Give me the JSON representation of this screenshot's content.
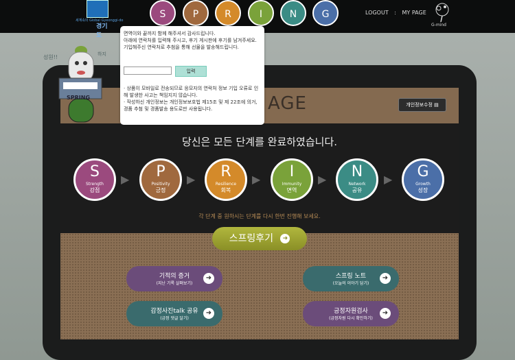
{
  "header": {
    "logo": {
      "text": "경기도",
      "sub": "세계속의 Global Gyeonggi-do"
    },
    "nav": [
      "S",
      "P",
      "R",
      "I",
      "N",
      "G"
    ],
    "logout": "LOGOUT",
    "separator": ":",
    "mypage": "MY PAGE",
    "gmind": "G-mind"
  },
  "mascot": {
    "label": "SPRING",
    "note1": "성원!!",
    "note2": "하지"
  },
  "popup": {
    "lines": [
      "면역이와 끝까지 함께 해주셔서 감사드립니다.",
      "아래에 연락처를 입력해 주시고, 후기 게시판에 후기를 남겨주세요.",
      "기입해주신 연락처로 추첨을 통해 선물을 발송해드립니다."
    ],
    "input_value": "",
    "submit": "입력",
    "notes": [
      "· 상품이 모바일로 전송되므로 응모자의 연락처 정보 기입 오류로 인해 발생한 사고는 책임지지 않습니다.",
      "· 작성하신 개인정보는 개인정보보호법 제15조 및 제 22조에 의거, 경품 추첨 및 경품발송 용도로만 사용됩니다."
    ]
  },
  "page": {
    "title": "AGE",
    "privacy_button": "개인정보수정",
    "complete_message": "당신은 모든 단계를 완료하였습니다.",
    "hint": "각 단계 중 원하시는 단계를 다시 한번 진행해 보세요.",
    "review_button": "스프링후기"
  },
  "steps": [
    {
      "letter": "S",
      "en": "Strength",
      "ko": "강점",
      "color": "#9b4a7e"
    },
    {
      "letter": "P",
      "en": "Positivity",
      "ko": "긍정",
      "color": "#a0693e"
    },
    {
      "letter": "R",
      "en": "Resilience",
      "ko": "회복",
      "color": "#d48a2a"
    },
    {
      "letter": "I",
      "en": "Immunity",
      "ko": "면역",
      "color": "#7aa23a"
    },
    {
      "letter": "N",
      "en": "Network",
      "ko": "공유",
      "color": "#3b8c85"
    },
    {
      "letter": "G",
      "en": "Growth",
      "ko": "성장",
      "color": "#4b6fa8"
    }
  ],
  "arrow_glyph": "▶",
  "action_glyph": "➜",
  "actions": [
    {
      "title": "기적의 증거",
      "sub": "(지난 기록 살펴보기)",
      "color": "#6b4c7a"
    },
    {
      "title": "스프링 노트",
      "sub": "(오늘의 이야기 담기)",
      "color": "#3a6b6d"
    },
    {
      "title": "감정사진talk 공유",
      "sub": "(긍정 댓글 달기)",
      "color": "#3a6b6d"
    },
    {
      "title": "긍정자원검사",
      "sub": "(긍정자원 다시 확인하기)",
      "color": "#6b4c7a"
    }
  ]
}
